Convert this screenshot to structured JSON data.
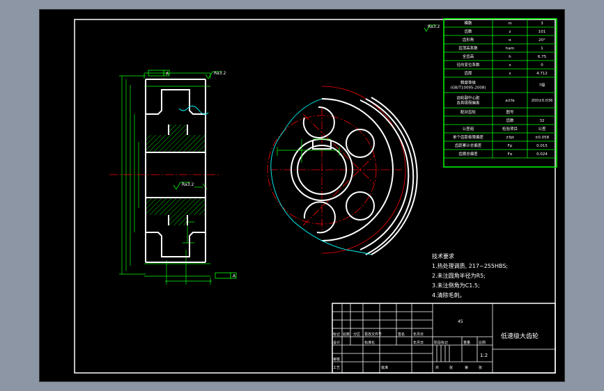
{
  "colors": {
    "background": "#000000",
    "frame": "#ffffff",
    "dimension": "#00ff00",
    "centerline": "#ff0000",
    "break_line": "#00ffff",
    "hatch": "#00ff00",
    "outline": "#ffffff"
  },
  "param_table": {
    "rows": [
      {
        "name": "模数",
        "symbol": "m",
        "value": "3"
      },
      {
        "name": "齿数",
        "symbol": "z",
        "value": "101"
      },
      {
        "name": "齿形角",
        "symbol": "α",
        "value": "20°"
      },
      {
        "name": "齿顶高系数",
        "symbol": "ham",
        "value": "1"
      },
      {
        "name": "全齿高",
        "symbol": "h",
        "value": "6.75"
      },
      {
        "name": "径向变位系数",
        "symbol": "x",
        "value": "0"
      },
      {
        "name": "齿厚",
        "symbol": "s",
        "value": "4.712"
      },
      {
        "name": "精度等级\n(GB/T10095-2008)",
        "symbol": "",
        "value": "7级"
      },
      {
        "name": "齿轮副中心距\n及其极限偏差",
        "symbol": "a±fa",
        "value": "200±0.036"
      },
      {
        "name": "配对齿轮",
        "symbol": "图号",
        "value": ""
      },
      {
        "name": "",
        "symbol": "齿数",
        "value": "32"
      },
      {
        "name": "公差组",
        "symbol": "检验项目",
        "value": "公差"
      },
      {
        "name": "单个齿距极限偏差",
        "symbol": "±fpt",
        "value": "±0.058"
      },
      {
        "name": "齿距累计总偏差",
        "symbol": "Fp",
        "value": "0.015"
      },
      {
        "name": "齿廓总偏差",
        "symbol": "Fα",
        "value": "0.024"
      }
    ]
  },
  "tech_requirements": {
    "title": "技术要求",
    "items": [
      "1.热处理调质, 217~255HBS;",
      "2.未注圆角半径为R5;",
      "3.未注倒角为C1.5;",
      "4.清除毛刺。"
    ]
  },
  "title_block": {
    "part_name": "低速级大齿轮",
    "material": "45",
    "scale": "1:2",
    "header_labels": [
      "标记",
      "处数",
      "分区",
      "更改文件号",
      "签名",
      "年月日"
    ],
    "row_labels": [
      "设计",
      "审核",
      "工艺",
      "批准"
    ],
    "mid_labels": [
      "标准化",
      "年月日"
    ],
    "stage_labels": [
      "阶段标记",
      "重量",
      "比例"
    ],
    "sheet_labels": [
      "共",
      "张",
      "第",
      "张"
    ]
  },
  "datum_labels": {
    "datum_a": "A",
    "roughness": "Ra3.2"
  }
}
